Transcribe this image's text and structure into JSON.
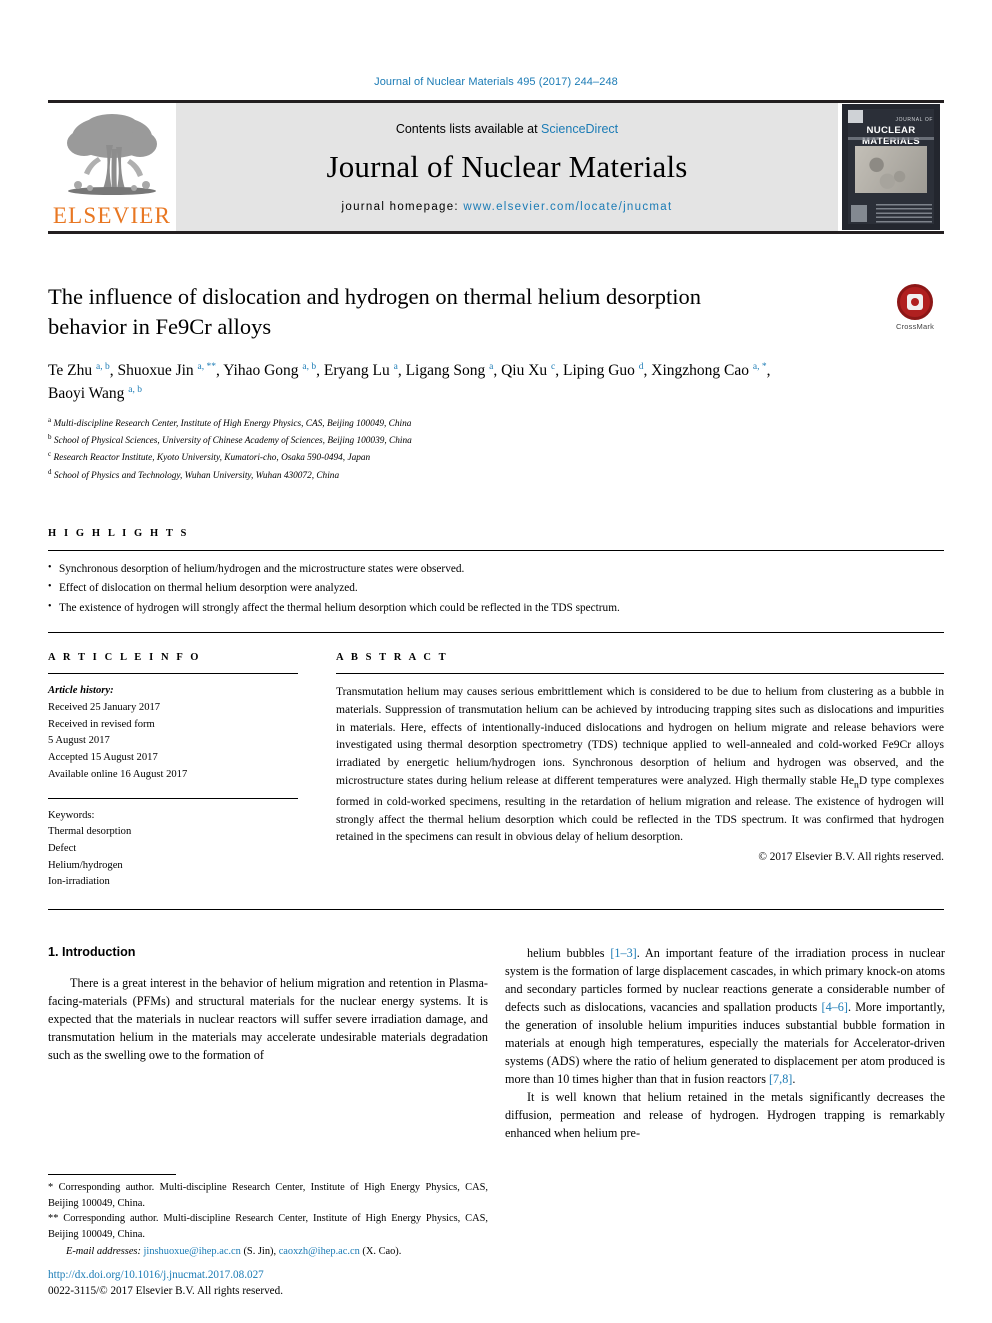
{
  "running_head": "Journal of Nuclear Materials 495 (2017) 244–248",
  "masthead": {
    "publisher_name": "ELSEVIER",
    "contents_prefix": "Contents lists available at ",
    "contents_link": "ScienceDirect",
    "journal_title": "Journal of Nuclear Materials",
    "homepage_label": "journal homepage: ",
    "homepage_url": "www.elsevier.com/locate/jnucmat",
    "cover": {
      "kicker": "JOURNAL OF",
      "title": "NUCLEAR MATERIALS"
    }
  },
  "article": {
    "title": "The influence of dislocation and hydrogen on thermal helium desorption behavior in Fe9Cr alloys",
    "crossmark_label": "CrossMark",
    "authors_html": "Te Zhu <sup>a, b</sup>, Shuoxue Jin <sup>a, **</sup>, Yihao Gong <sup>a, b</sup>, Eryang Lu <sup>a</sup>, Ligang Song <sup>a</sup>, Qiu Xu <sup>c</sup>, Liping Guo <sup>d</sup>, Xingzhong Cao <sup>a, *</sup>, Baoyi Wang <sup>a, b</sup>",
    "affiliations": [
      {
        "mark": "a",
        "text": "Multi-discipline Research Center, Institute of High Energy Physics, CAS, Beijing 100049, China"
      },
      {
        "mark": "b",
        "text": "School of Physical Sciences, University of Chinese Academy of Sciences, Beijing 100039, China"
      },
      {
        "mark": "c",
        "text": "Research Reactor Institute, Kyoto University, Kumatori-cho, Osaka 590-0494, Japan"
      },
      {
        "mark": "d",
        "text": "School of Physics and Technology, Wuhan University, Wuhan 430072, China"
      }
    ]
  },
  "highlights": {
    "heading": "H I G H L I G H T S",
    "items": [
      "Synchronous desorption of helium/hydrogen and the microstructure states were observed.",
      "Effect of dislocation on thermal helium desorption were analyzed.",
      "The existence of hydrogen will strongly affect the thermal helium desorption which could be reflected in the TDS spectrum."
    ]
  },
  "article_info": {
    "heading": "A R T I C L E  I N F O",
    "history_label": "Article history:",
    "history_lines": [
      "Received 25 January 2017",
      "Received in revised form",
      "5 August 2017",
      "Accepted 15 August 2017",
      "Available online 16 August 2017"
    ],
    "keywords_label": "Keywords:",
    "keywords": [
      "Thermal desorption",
      "Defect",
      "Helium/hydrogen",
      "Ion-irradiation"
    ]
  },
  "abstract": {
    "heading": "A B S T R A C T",
    "text_html": "Transmutation helium may causes serious embrittlement which is considered to be due to helium from clustering as a bubble in materials. Suppression of transmutation helium can be achieved by introducing trapping sites such as dislocations and impurities in materials. Here, effects of intentionally-induced dislocations and hydrogen on helium migrate and release behaviors were investigated using thermal desorption spectrometry (TDS) technique applied to well-annealed and cold-worked Fe9Cr alloys irradiated by energetic helium/hydrogen ions. Synchronous desorption of helium and hydrogen was observed, and the microstructure states during helium release at different temperatures were analyzed. High thermally stable He<sub>n</sub>D type complexes formed in cold-worked specimens, resulting in the retardation of helium migration and release. The existence of hydrogen will strongly affect the thermal helium desorption which could be reflected in the TDS spectrum. It was confirmed that hydrogen retained in the specimens can result in obvious delay of helium desorption.",
    "copyright": "© 2017 Elsevier B.V. All rights reserved."
  },
  "body": {
    "section_title": "1.  Introduction",
    "left_paragraphs_html": [
      "There is a great interest in the behavior of helium migration and retention in Plasma-facing-materials (PFMs) and structural materials for the nuclear energy systems. It is expected that the materials in nuclear reactors will suffer severe irradiation damage, and transmutation helium in the materials may accelerate undesirable materials degradation such as the swelling owe to the formation of"
    ],
    "right_paragraphs_html": [
      "helium bubbles <span class=\"ref\">[1&ndash;3]</span>. An important feature of the irradiation process in nuclear system is the formation of large displacement cascades, in which primary knock-on atoms and secondary particles formed by nuclear reactions generate a considerable number of defects such as dislocations, vacancies and spallation products <span class=\"ref\">[4&ndash;6]</span>. More importantly, the generation of insoluble helium impurities induces substantial bubble formation in materials at enough high temperatures, especially the materials for Accelerator-driven systems (ADS) where the ratio of helium generated to displacement per atom produced is more than 10 times higher than that in fusion reactors <span class=\"ref\">[7,8]</span>.",
      "It is well known that helium retained in the metals significantly decreases the diffusion, permeation and release of hydrogen. Hydrogen trapping is remarkably enhanced when helium pre-"
    ]
  },
  "footnotes": {
    "line1": "* Corresponding author. Multi-discipline Research Center, Institute of High Energy Physics, CAS, Beijing 100049, China.",
    "line2": "** Corresponding author. Multi-discipline Research Center, Institute of High Energy Physics, CAS, Beijing 100049, China.",
    "emails_label": "E-mail addresses:",
    "email1": "jinshuoxue@ihep.ac.cn",
    "email1_owner": "(S. Jin),",
    "email2": "caoxzh@ihep.ac.cn",
    "email2_owner": "(X. Cao)."
  },
  "doi_block": {
    "doi": "http://dx.doi.org/10.1016/j.jnucmat.2017.08.027",
    "issn_line": "0022-3115/© 2017 Elsevier B.V. All rights reserved."
  },
  "colors": {
    "link": "#1b7bb5",
    "elsevier_orange": "#E87722",
    "crossmark_red": "#b02020",
    "masthead_gray": "#e4e4e4"
  }
}
